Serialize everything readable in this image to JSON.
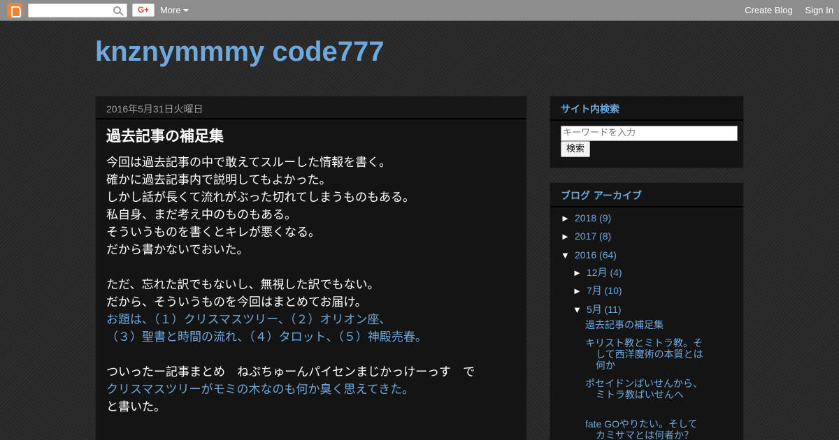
{
  "navbar": {
    "gplus_label": "G+",
    "more_label": "More",
    "create_blog": "Create Blog",
    "sign_in": "Sign In"
  },
  "blog": {
    "title": "knznymmmy code777"
  },
  "post": {
    "date": "2016年5月31日火曜日",
    "title": "過去記事の補足集",
    "lines": [
      {
        "text": "今回は過去記事の中で敢えてスルーした情報を書く。",
        "link": false
      },
      {
        "text": "確かに過去記事内で説明してもよかった。",
        "link": false
      },
      {
        "text": "しかし話が長くて流れがぶった切れてしまうものもある。",
        "link": false
      },
      {
        "text": "私自身、まだ考え中のものもある。",
        "link": false
      },
      {
        "text": "そういうものを書くとキレが悪くなる。",
        "link": false
      },
      {
        "text": "だから書かないでおいた。",
        "link": false
      },
      {
        "text": "",
        "link": false
      },
      {
        "text": "ただ、忘れた訳でもないし、無視した訳でもない。",
        "link": false
      },
      {
        "text": "だから、そういうものを今回はまとめてお届け。",
        "link": false
      },
      {
        "text": "お題は、（１）クリスマスツリー、（２）オリオン座、",
        "link": true
      },
      {
        "text": "（３）聖書と時間の流れ、（４）タロット、（５）神殿売春。",
        "link": true
      },
      {
        "text": "",
        "link": false
      },
      {
        "text": "ついったー記事まとめ　ねぷちゅーんパイセンまじかっけーっす　で",
        "link": false
      },
      {
        "text": "クリスマスツリーがモミの木なのも何か臭く思えてきた。",
        "link": true
      },
      {
        "text": "と書いた。",
        "link": false
      }
    ]
  },
  "sidebar": {
    "search": {
      "title": "サイト内検索",
      "placeholder": "キーワードを入力",
      "button": "検索"
    },
    "archive": {
      "title": "ブログ アーカイブ",
      "collapsed_glyph": "►",
      "expanded_glyph": "▼",
      "years": [
        {
          "label": "2018 (9)",
          "expanded": false
        },
        {
          "label": "2017 (8)",
          "expanded": false
        },
        {
          "label": "2016 (64)",
          "expanded": true
        }
      ],
      "months": [
        {
          "label": "12月 (4)",
          "expanded": false
        },
        {
          "label": "7月 (10)",
          "expanded": false
        },
        {
          "label": "5月 (11)",
          "expanded": true
        }
      ],
      "posts": [
        "過去記事の補足集",
        "キリスト教とミトラ教。そして西洋魔術の本質とは何か",
        "ポセイドンぱいせんから、ミトラ教ぱいせんへ",
        "fate GOやりたい。そしてカミサマとは何者か？"
      ]
    }
  }
}
